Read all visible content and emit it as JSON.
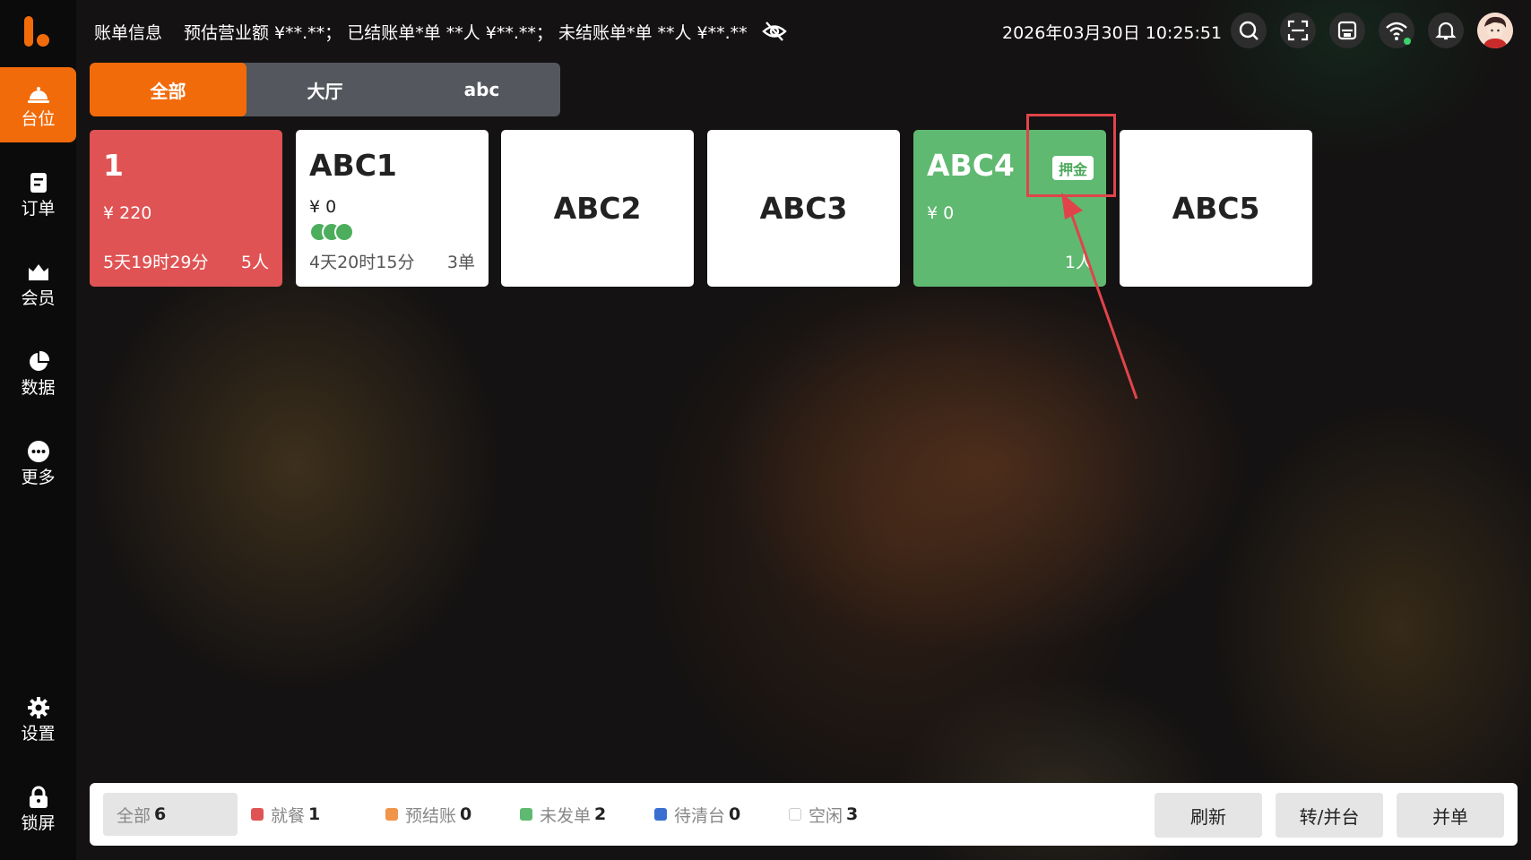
{
  "sidebar": {
    "items": [
      {
        "label": "台位",
        "icon": "table-service-icon",
        "active": true
      },
      {
        "label": "订单",
        "icon": "order-icon"
      },
      {
        "label": "会员",
        "icon": "member-icon"
      },
      {
        "label": "数据",
        "icon": "pie-chart-icon"
      },
      {
        "label": "更多",
        "icon": "more-icon"
      },
      {
        "label": "设置",
        "icon": "gear-icon"
      },
      {
        "label": "锁屏",
        "icon": "lock-icon"
      }
    ]
  },
  "topbar": {
    "bill_title": "账单信息",
    "bill_summary": "预估营业额 ¥**.**； 已结账单*单 **人 ¥**.**； 未结账单*单 **人 ¥**.**",
    "datetime": "2026年03月30日 10:25:51",
    "icons": [
      "search-icon",
      "scan-icon",
      "printer-icon",
      "wifi-icon",
      "bell-icon",
      "avatar"
    ]
  },
  "tabs": [
    {
      "label": "全部",
      "active": true
    },
    {
      "label": "大厅"
    },
    {
      "label": "abc"
    }
  ],
  "tables": [
    {
      "name": "1",
      "status": "dining",
      "amount": "¥ 220",
      "time": "5天19时29分",
      "count": "5人"
    },
    {
      "name": "ABC1",
      "status": "pending",
      "amount": "¥ 0",
      "dots": 3,
      "time": "4天20时15分",
      "count": "3单"
    },
    {
      "name": "ABC2",
      "status": "idle"
    },
    {
      "name": "ABC3",
      "status": "idle"
    },
    {
      "name": "ABC4",
      "status": "deposit",
      "amount": "¥ 0",
      "badge": "押金",
      "count": "1人"
    },
    {
      "name": "ABC5",
      "status": "idle"
    }
  ],
  "bottombar": {
    "all": {
      "label": "全部",
      "count": "6"
    },
    "legend": [
      {
        "label": "就餐",
        "count": "1",
        "color": "#e05354"
      },
      {
        "label": "预结账",
        "count": "0",
        "color": "#f0954a"
      },
      {
        "label": "未发单",
        "count": "2",
        "color": "#5fb970"
      },
      {
        "label": "待清台",
        "count": "0",
        "color": "#3a6fd1"
      },
      {
        "label": "空闲",
        "count": "3",
        "color": "#ffffff"
      }
    ],
    "buttons": [
      "刷新",
      "转/并台",
      "并单"
    ]
  },
  "colors": {
    "accent": "#f26b0a",
    "dining": "#e05354",
    "deposit": "#5fb970",
    "annotation": "#e0444a"
  }
}
